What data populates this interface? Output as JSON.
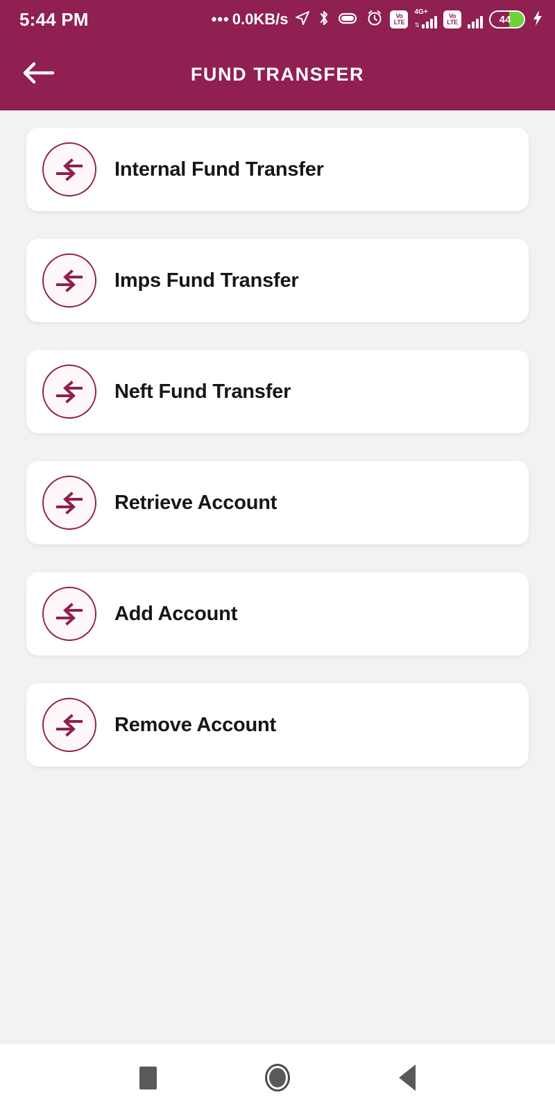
{
  "colors": {
    "brand": "#8f2051",
    "page_bg": "#f1f2f4",
    "card_bg": "#ffffff",
    "icon_bg": "#fdf7f9",
    "text": "#161616",
    "battery_green": "#6fd23a"
  },
  "status_bar": {
    "clock": "5:44 PM",
    "network_speed": "0.0KB/s",
    "speed_dots": "•••",
    "icons": [
      "location-arrow-icon",
      "bluetooth-icon",
      "data-saver-icon",
      "alarm-clock-icon",
      "volte-sim1-icon",
      "signal-sim1-icon",
      "volte-sim2-icon",
      "signal-sim2-icon"
    ],
    "sim1_network": "4G+",
    "volte_top": "Vo",
    "volte_bottom": "LTE",
    "battery_level": "44",
    "charging": true
  },
  "app_bar": {
    "title": "FUND TRANSFER",
    "back_icon": "arrow-left-icon"
  },
  "menu": {
    "items": [
      {
        "label": "Internal Fund Transfer",
        "icon": "transfer-arrows-icon"
      },
      {
        "label": "Imps Fund Transfer",
        "icon": "transfer-arrows-icon"
      },
      {
        "label": "Neft Fund Transfer",
        "icon": "transfer-arrows-icon"
      },
      {
        "label": "Retrieve Account",
        "icon": "transfer-arrows-icon"
      },
      {
        "label": "Add Account",
        "icon": "transfer-arrows-icon"
      },
      {
        "label": "Remove Account",
        "icon": "transfer-arrows-icon"
      }
    ]
  },
  "nav_bar": {
    "recents_label": "recents-button",
    "home_label": "home-button",
    "back_label": "back-button"
  }
}
